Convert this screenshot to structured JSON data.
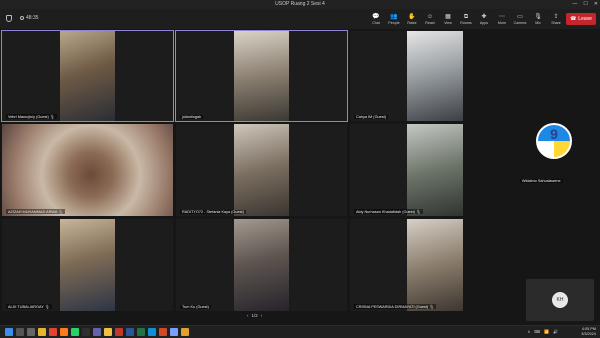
{
  "window": {
    "title": "USOP Ruang 2 Sesi 4",
    "controls": [
      "—",
      "☐",
      "✕"
    ]
  },
  "meeting": {
    "elapsed": "48:35"
  },
  "toolbar": [
    {
      "label": "Chat",
      "icon": "chat-icon",
      "glyph": "💬"
    },
    {
      "label": "People",
      "icon": "people-icon",
      "glyph": "👥"
    },
    {
      "label": "Raise",
      "icon": "raise-hand-icon",
      "glyph": "✋"
    },
    {
      "label": "React",
      "icon": "react-icon",
      "glyph": "☺"
    },
    {
      "label": "View",
      "icon": "view-icon",
      "glyph": "▦"
    },
    {
      "label": "Rooms",
      "icon": "rooms-icon",
      "glyph": "⧉"
    },
    {
      "label": "Apps",
      "icon": "apps-icon",
      "glyph": "✚"
    },
    {
      "label": "More",
      "icon": "more-icon",
      "glyph": "⋯"
    },
    {
      "label": "Camera",
      "icon": "camera-icon",
      "glyph": "▭"
    },
    {
      "label": "Mic",
      "icon": "mic-icon",
      "glyph": "🎙"
    },
    {
      "label": "Share",
      "icon": "share-icon",
      "glyph": "⇪"
    }
  ],
  "leave": {
    "label": "Leave",
    "glyph": "☎"
  },
  "participants": [
    {
      "name": "Vebri Manurjiniy (Guest)",
      "mic": "🎙",
      "active": true
    },
    {
      "name": "juliantingah",
      "mic": "",
      "active": true
    },
    {
      "name": "Cahya IM (Guest)",
      "mic": "",
      "active": false
    },
    {
      "name": "AZIZAH MUHAMMAD ARWA",
      "mic": "🎙",
      "active": false
    },
    {
      "name": "RADITYO72 - Stefania Kaya (Guest)",
      "mic": "",
      "active": false
    },
    {
      "name": "Aldy Nurhasan Khadafidah (Guest)",
      "mic": "🎙",
      "active": false
    },
    {
      "name": "ALDI TUBALIAROAY",
      "mic": "🎙",
      "active": false
    },
    {
      "name": "Tum Ku (Guest)",
      "mic": "",
      "active": false
    },
    {
      "name": "CRISNA PESWARDIA DIRMAYATI (Guest)",
      "mic": "🎙",
      "active": false
    }
  ],
  "side": {
    "name": "Widalmo Sahuslawene",
    "logo_text": "9"
  },
  "self": {
    "initials": "KH"
  },
  "pager": {
    "prev": "‹",
    "page": "1/2",
    "next": "›"
  },
  "taskbar": {
    "icons": [
      {
        "name": "windows-start-icon",
        "color": "#3b8fe8"
      },
      {
        "name": "search-icon",
        "color": "#555"
      },
      {
        "name": "task-view-icon",
        "color": "#666"
      },
      {
        "name": "file-explorer-icon",
        "color": "#e8b232"
      },
      {
        "name": "chrome-icon",
        "color": "#e34234"
      },
      {
        "name": "browser-icon",
        "color": "#ff7a1a"
      },
      {
        "name": "whatsapp-icon",
        "color": "#25d366"
      },
      {
        "name": "app-icon",
        "color": "#2f2f2f"
      },
      {
        "name": "teams-icon",
        "color": "#6264a7"
      },
      {
        "name": "folder-icon",
        "color": "#f0c040"
      },
      {
        "name": "app-icon",
        "color": "#c0392b"
      },
      {
        "name": "word-icon",
        "color": "#2b579a"
      },
      {
        "name": "excel-icon",
        "color": "#217346"
      },
      {
        "name": "edge-icon",
        "color": "#0f8fd8"
      },
      {
        "name": "powerpoint-icon",
        "color": "#d24726"
      },
      {
        "name": "app-icon",
        "color": "#7aa0ff"
      },
      {
        "name": "app-icon",
        "color": "#e0a030"
      }
    ],
    "tray_icons": [
      "∧",
      "⌨",
      "📶",
      "🔊"
    ],
    "time": "4:05 PM",
    "date": "3/3/2024"
  }
}
